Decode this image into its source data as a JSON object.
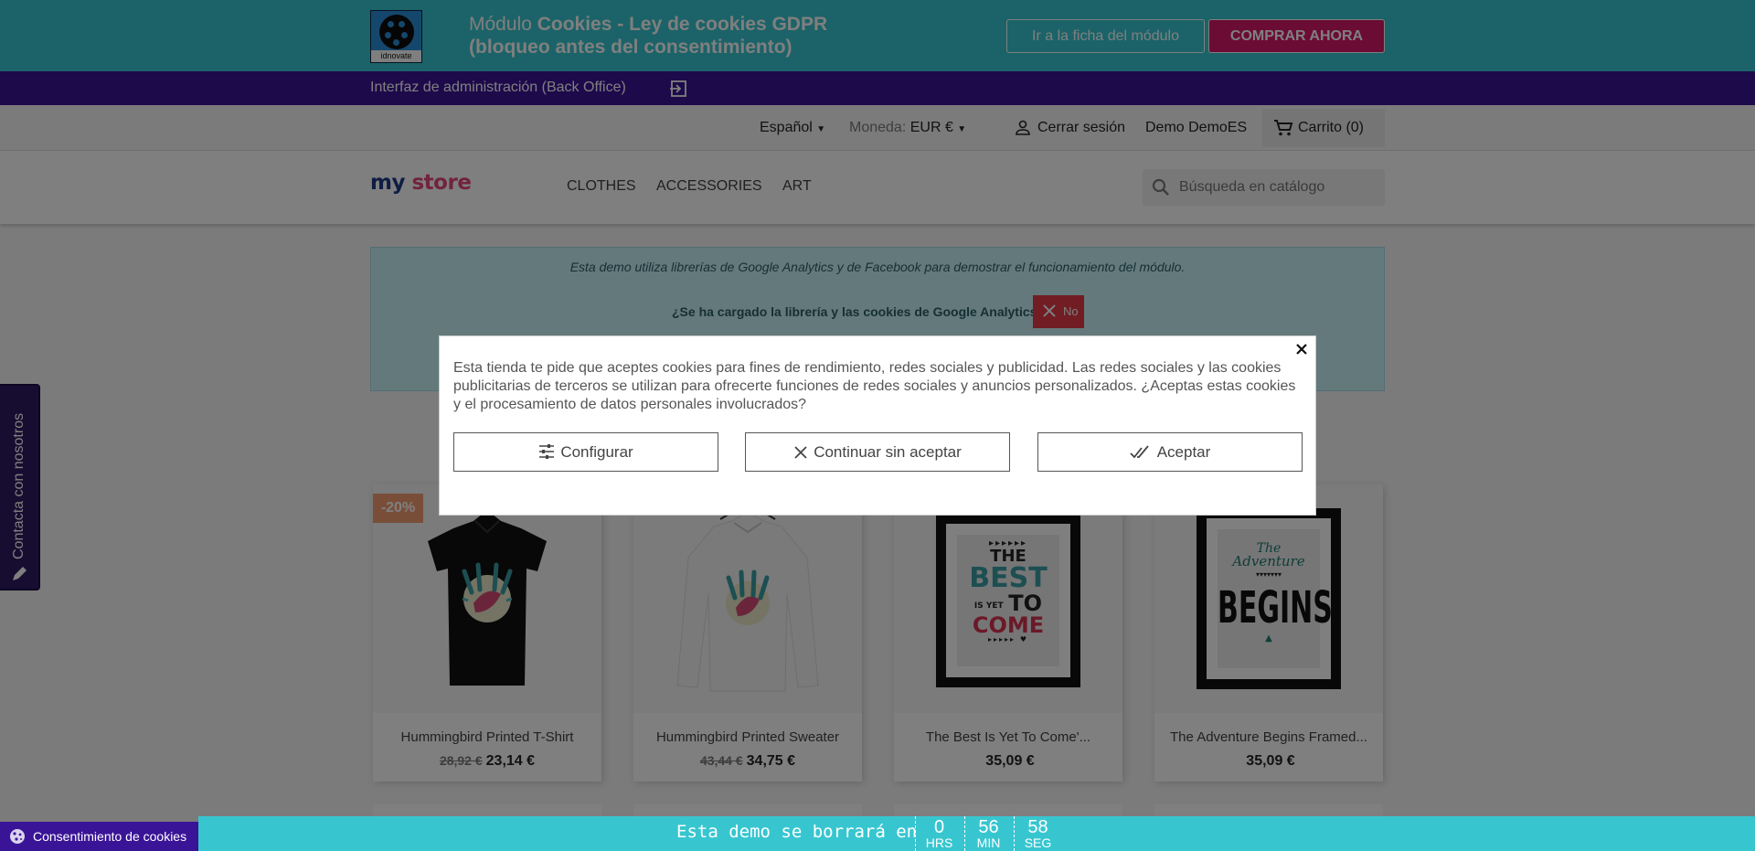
{
  "promo": {
    "logo_text": "idnovate",
    "title_prefix": "Módulo ",
    "title_bold": "Cookies - Ley de cookies GDPR (bloqueo antes del consentimiento)",
    "module_button": "Ir a la ficha del módulo",
    "buy_button": "COMPRAR AHORA"
  },
  "admin_bar": {
    "link": "Interfaz de administración (Back Office)"
  },
  "user_nav": {
    "language": "Español",
    "currency_label": "Moneda:",
    "currency_value": "EUR €",
    "logout": "Cerrar sesión",
    "user_name": "Demo DemoES",
    "cart": "Carrito (0)"
  },
  "header": {
    "logo": {
      "part1": "my",
      "part2": "store"
    },
    "menu": [
      "CLOTHES",
      "ACCESSORIES",
      "ART"
    ],
    "search_placeholder": "Búsqueda en catálogo"
  },
  "info_box": {
    "line1": "Esta demo utiliza librerías de Google Analytics y de Facebook para demostrar el funcionamiento del módulo.",
    "line2": "¿Se ha cargado la librería y las cookies de Google Analytics?",
    "status": "No"
  },
  "products": [
    {
      "name": "Hummingbird Printed T-Shirt",
      "old_price": "28,92 €",
      "price": "23,14 €",
      "badge": "-20%"
    },
    {
      "name": "Hummingbird Printed Sweater",
      "old_price": "43,44 €",
      "price": "34,75 €",
      "badge": ""
    },
    {
      "name": "The Best Is Yet To Come'...",
      "old_price": "",
      "price": "35,09 €",
      "badge": ""
    },
    {
      "name": "The Adventure Begins Framed...",
      "old_price": "",
      "price": "35,09 €",
      "badge": ""
    }
  ],
  "poster_best": {
    "l1": "THE",
    "l2": "BEST",
    "l3": "IS YET",
    "l4": "TO",
    "l5": "COME"
  },
  "poster_adventure": {
    "l1": "The",
    "l2": "Adventure",
    "l3": "BEGINS"
  },
  "contact_tab": "Contacta con nosotros",
  "modal": {
    "message": "Esta tienda te pide que aceptes cookies para fines de rendimiento, redes sociales y publicidad. Las redes sociales y las cookies publicitarias de terceros se utilizan para ofrecerte funciones de redes sociales y anuncios personalizados. ¿Aceptas estas cookies y el procesamiento de datos personales involucrados?",
    "configure": "Configurar",
    "continue_without": "Continuar sin aceptar",
    "accept": "Aceptar"
  },
  "cookie_badge": "Consentimiento de cookies",
  "countdown": {
    "label": "Esta demo se borrará en",
    "hours": "0",
    "hours_unit": "HRS",
    "minutes": "56",
    "minutes_unit": "MIN",
    "seconds": "58",
    "seconds_unit": "SEG"
  },
  "colors": {
    "promo_bg": "#37c6d0",
    "admin_bg": "#3a1497",
    "buy_button": "#d6186b",
    "status_no": "#e33a46",
    "discount_badge": "#f39d72"
  }
}
